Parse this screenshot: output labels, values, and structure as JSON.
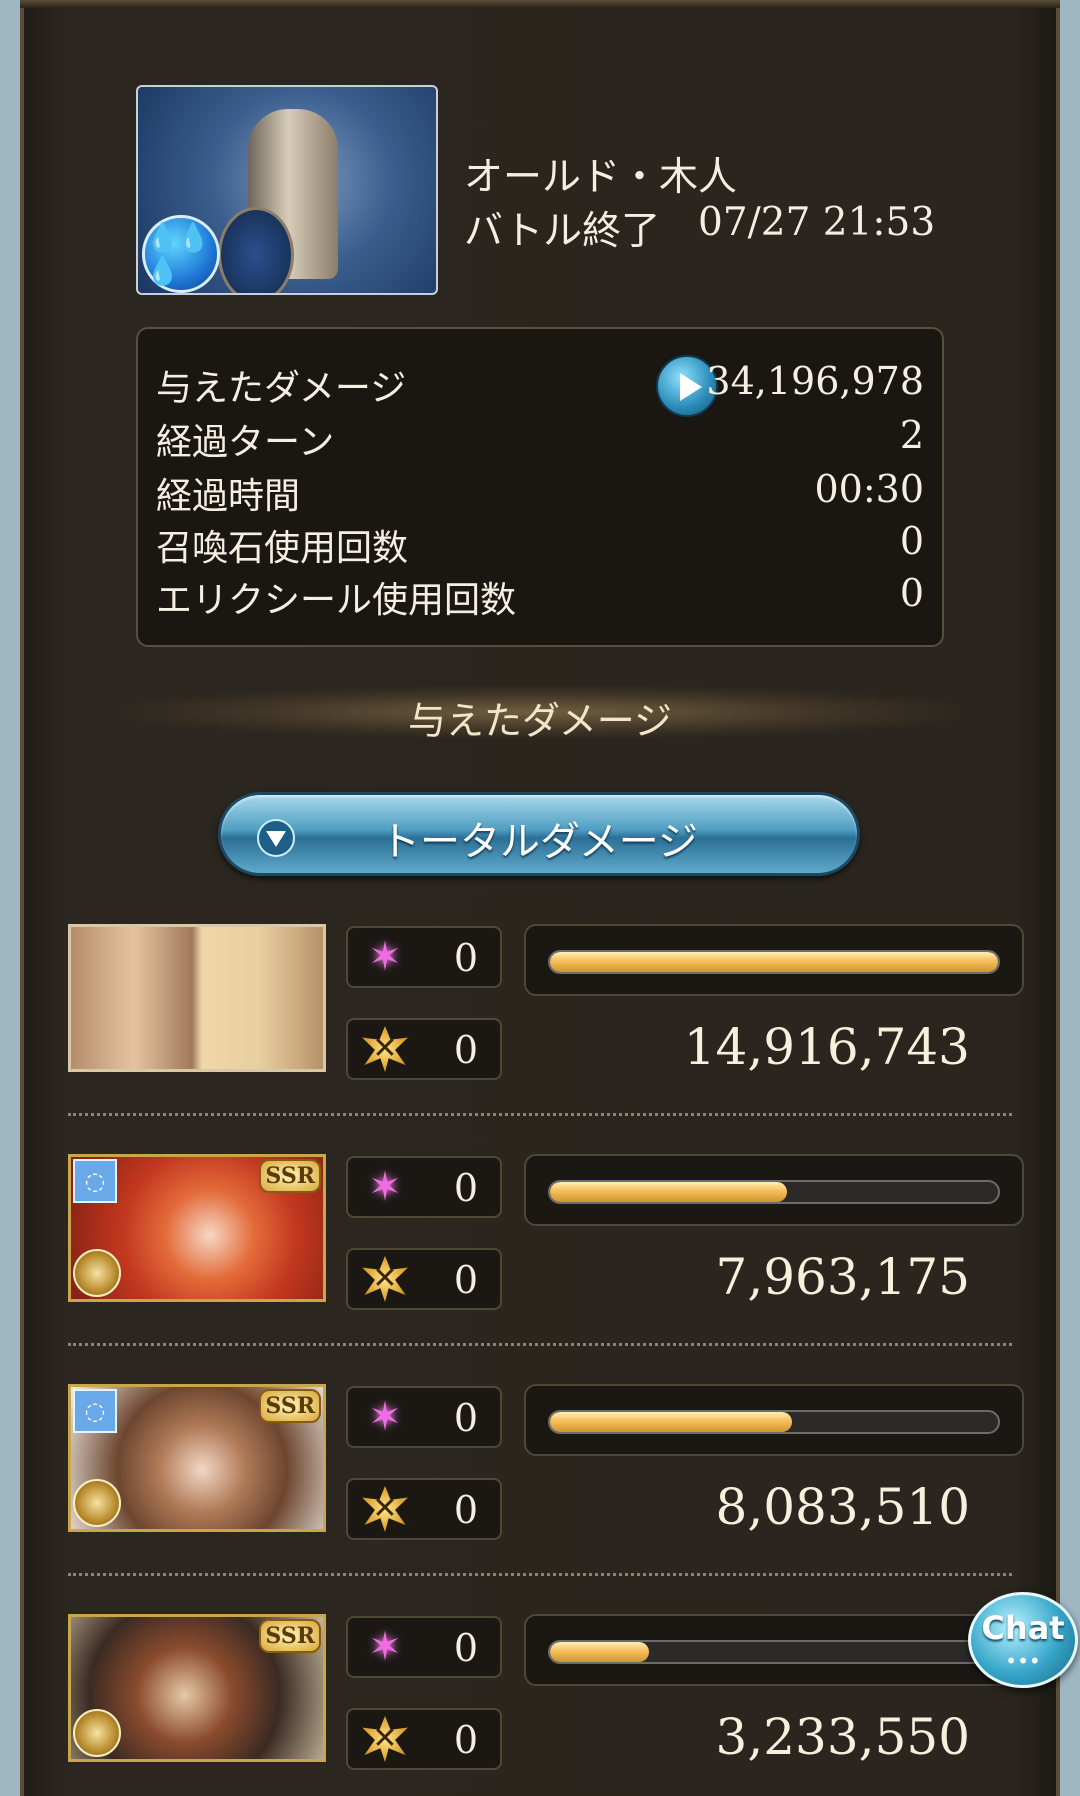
{
  "header": {
    "boss_name": "オールド・木人",
    "battle_status": "バトル終了",
    "battle_datetime": "07/27 21:53",
    "element_icon": "water-element-icon"
  },
  "stats": {
    "rows": [
      {
        "label": "与えたダメージ",
        "value": "34,196,978"
      },
      {
        "label": "経過ターン",
        "value": "2"
      },
      {
        "label": "経過時間",
        "value": "00:30"
      },
      {
        "label": "召喚石使用回数",
        "value": "0"
      },
      {
        "label": "エリクシール使用回数",
        "value": "0"
      }
    ]
  },
  "section_title": "与えたダメージ",
  "dropdown": {
    "label": "トータルダメージ"
  },
  "characters": [
    {
      "ssr": "",
      "ability_uses": "0",
      "ca_uses": "0",
      "damage": "14,916,743",
      "bar_fraction": 1.0
    },
    {
      "ssr": "SSR",
      "ability_uses": "0",
      "ca_uses": "0",
      "damage": "7,963,175",
      "bar_fraction": 0.53
    },
    {
      "ssr": "SSR",
      "ability_uses": "0",
      "ca_uses": "0",
      "damage": "8,083,510",
      "bar_fraction": 0.54
    },
    {
      "ssr": "SSR",
      "ability_uses": "0",
      "ca_uses": "0",
      "damage": "3,233,550",
      "bar_fraction": 0.22
    }
  ],
  "chat": {
    "label": "Chat",
    "dots": "•••"
  },
  "colors": {
    "bar_fill": "#f6c362",
    "accent_blue": "#4e9dc1",
    "frame": "#2a251e"
  }
}
